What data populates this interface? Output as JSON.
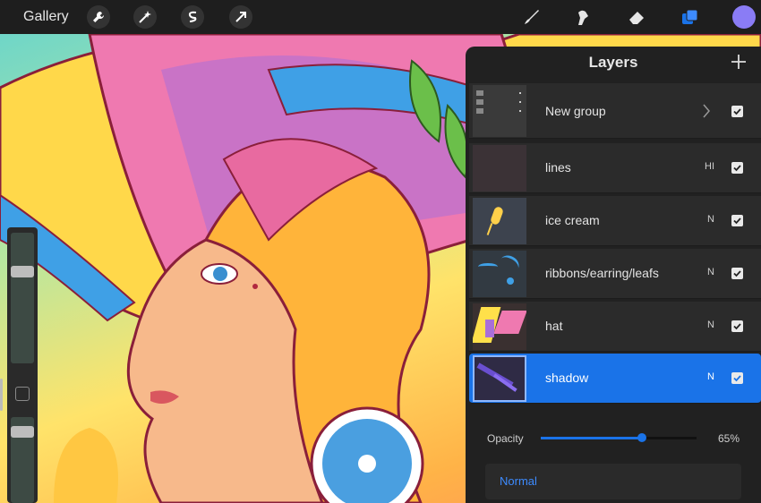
{
  "toolbar": {
    "gallery_label": "Gallery",
    "left_tools": [
      "wrench-icon",
      "magic-wand-icon",
      "selection-icon",
      "transform-arrow-icon"
    ],
    "right_tools": [
      "brush-icon",
      "smudge-icon",
      "eraser-icon",
      "layers-icon"
    ],
    "current_color": "#8a7cf5",
    "accent": "#1a73e8"
  },
  "layers_panel": {
    "title": "Layers",
    "add_icon": "plus-icon",
    "layers": [
      {
        "name": "New group",
        "blend": "",
        "visible": true,
        "group": true
      },
      {
        "name": "lines",
        "blend": "HI",
        "visible": true
      },
      {
        "name": "ice cream",
        "blend": "N",
        "visible": true
      },
      {
        "name": "ribbons/earring/leafs",
        "blend": "N",
        "visible": true
      },
      {
        "name": "hat",
        "blend": "N",
        "visible": true
      },
      {
        "name": "shadow",
        "blend": "N",
        "visible": true,
        "selected": true
      }
    ],
    "opacity_label": "Opacity",
    "opacity_value": "65%",
    "opacity_fraction": 0.65,
    "blend_mode": "Normal"
  },
  "sidebar": {
    "brush_size_level": 0.72,
    "brush_opacity_level": 0.88
  }
}
